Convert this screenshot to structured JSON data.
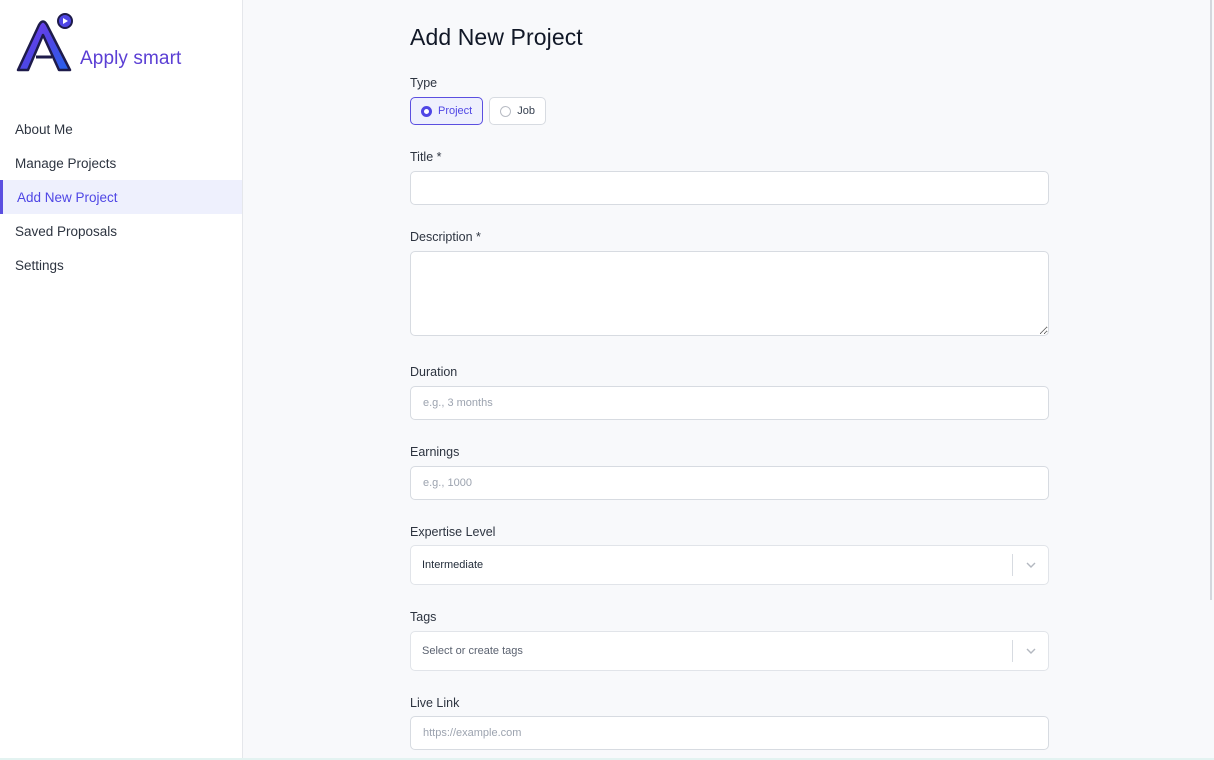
{
  "app": {
    "name": "Apply smart",
    "brand_color": "#5b3fd4",
    "logo_icon": "apply-smart-logo"
  },
  "sidebar": {
    "items": [
      {
        "label": "About Me",
        "active": false
      },
      {
        "label": "Manage Projects",
        "active": false
      },
      {
        "label": "Add New Project",
        "active": true
      },
      {
        "label": "Saved Proposals",
        "active": false
      },
      {
        "label": "Settings",
        "active": false
      }
    ]
  },
  "form": {
    "title": "Add New Project",
    "type": {
      "label": "Type",
      "options": [
        "Project",
        "Job"
      ],
      "selected": "Project"
    },
    "title_field": {
      "label": "Title *",
      "value": ""
    },
    "description": {
      "label": "Description *",
      "value": ""
    },
    "duration": {
      "label": "Duration",
      "placeholder": "e.g., 3 months"
    },
    "earnings": {
      "label": "Earnings",
      "placeholder": "e.g., 1000"
    },
    "expertise": {
      "label": "Expertise Level",
      "value": "Intermediate"
    },
    "tags": {
      "label": "Tags",
      "placeholder": "Select or create tags"
    },
    "live_link": {
      "label": "Live Link",
      "placeholder": "https://example.com"
    }
  },
  "colors": {
    "accent": "#4f46e5",
    "active_bg": "#eef0fd"
  }
}
